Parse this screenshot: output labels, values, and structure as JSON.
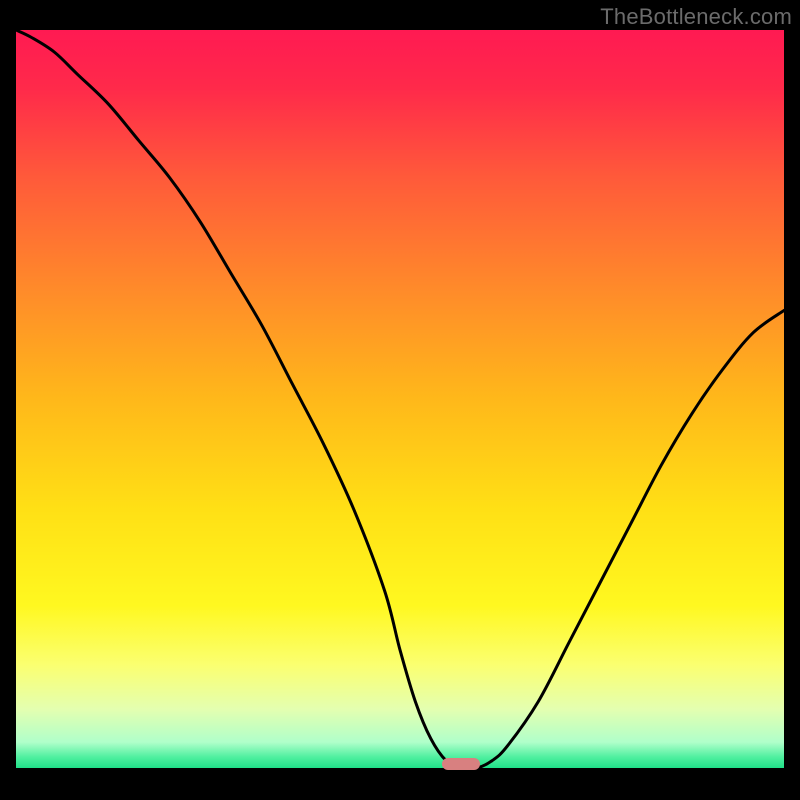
{
  "watermark": "TheBottleneck.com",
  "colors": {
    "gradient_stops": [
      {
        "offset": 0.0,
        "color": "#ff1a52"
      },
      {
        "offset": 0.08,
        "color": "#ff2a4a"
      },
      {
        "offset": 0.2,
        "color": "#ff5a3a"
      },
      {
        "offset": 0.35,
        "color": "#ff8a2a"
      },
      {
        "offset": 0.5,
        "color": "#ffb81a"
      },
      {
        "offset": 0.65,
        "color": "#ffe015"
      },
      {
        "offset": 0.78,
        "color": "#fff820"
      },
      {
        "offset": 0.86,
        "color": "#fbff70"
      },
      {
        "offset": 0.92,
        "color": "#e4ffb0"
      },
      {
        "offset": 0.965,
        "color": "#b0ffca"
      },
      {
        "offset": 0.985,
        "color": "#50f0a0"
      },
      {
        "offset": 1.0,
        "color": "#20e088"
      }
    ],
    "curve_stroke": "#000000",
    "marker_fill": "#d88080",
    "background": "#000000"
  },
  "chart_data": {
    "type": "line",
    "title": "",
    "xlabel": "",
    "ylabel": "",
    "xlim": [
      0,
      100
    ],
    "ylim": [
      0,
      100
    ],
    "x": [
      0,
      2,
      5,
      8,
      12,
      16,
      20,
      24,
      28,
      32,
      36,
      40,
      44,
      48,
      50,
      52,
      54,
      56,
      58,
      60,
      62,
      64,
      68,
      72,
      76,
      80,
      84,
      88,
      92,
      96,
      100
    ],
    "values": [
      100,
      99,
      97,
      94,
      90,
      85,
      80,
      74,
      67,
      60,
      52,
      44,
      35,
      24,
      16,
      9,
      4,
      1,
      0,
      0,
      1,
      3,
      9,
      17,
      25,
      33,
      41,
      48,
      54,
      59,
      62
    ],
    "bottleneck_x": 58,
    "grid": false,
    "legend": false
  }
}
